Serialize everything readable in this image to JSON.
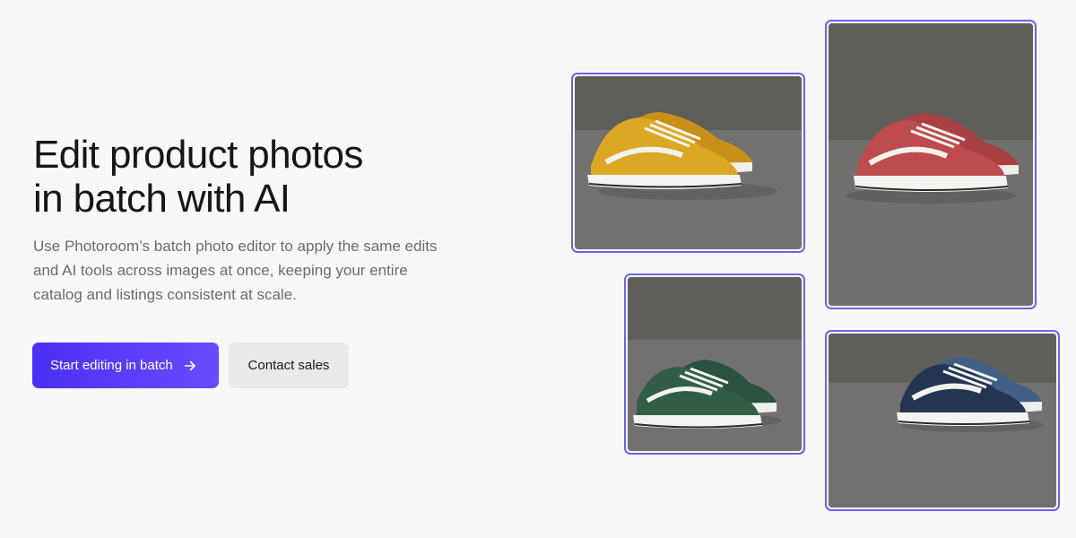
{
  "hero": {
    "headline_line1": "Edit product photos",
    "headline_line2": "in batch with AI",
    "subtext": "Use Photoroom’s batch photo editor to apply the same edits and AI tools across images at once, keeping your entire catalog and listings consistent at scale."
  },
  "actions": {
    "primary_label": "Start editing in batch",
    "primary_icon": "arrow-right-icon",
    "secondary_label": "Contact sales"
  },
  "gallery": [
    {
      "subject": "yellow sneakers",
      "color": "#d9a21f"
    },
    {
      "subject": "red sneakers",
      "color": "#b84a4c"
    },
    {
      "subject": "green sneakers",
      "color": "#2f5a43"
    },
    {
      "subject": "navy blue sneakers",
      "color": "#2a3f5e"
    }
  ],
  "colors": {
    "accent": "#4b2ff5",
    "frame": "#6b63e6",
    "background": "#f8f8f9"
  }
}
